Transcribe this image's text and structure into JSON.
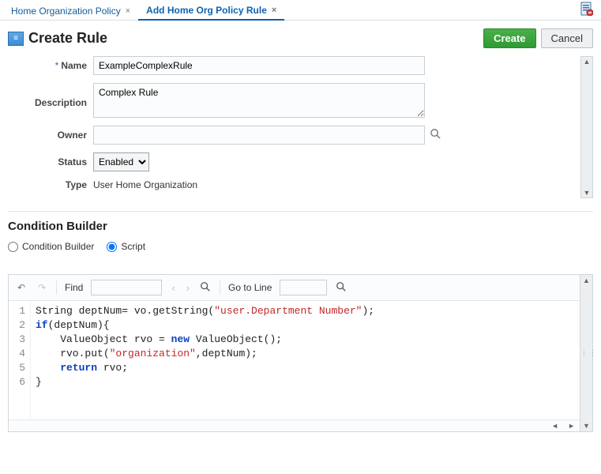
{
  "tabs": [
    {
      "label": "Home Organization Policy",
      "active": false
    },
    {
      "label": "Add Home Org Policy Rule",
      "active": true
    }
  ],
  "header": {
    "title": "Create Rule",
    "create_btn": "Create",
    "cancel_btn": "Cancel"
  },
  "form": {
    "name_label": "Name",
    "name_value": "ExampleComplexRule",
    "desc_label": "Description",
    "desc_value": "Complex Rule",
    "owner_label": "Owner",
    "owner_value": "",
    "status_label": "Status",
    "status_value": "Enabled",
    "type_label": "Type",
    "type_value": "User Home Organization"
  },
  "cond": {
    "section_title": "Condition Builder",
    "opt_builder": "Condition Builder",
    "opt_script": "Script"
  },
  "toolbar": {
    "find_label": "Find",
    "goto_label": "Go to Line"
  },
  "code": {
    "lines": [
      "String deptNum= vo.getString(\"user.Department Number\");",
      "if(deptNum){",
      "    ValueObject rvo = new ValueObject();",
      "    rvo.put(\"organization\",deptNum);",
      "    return rvo;",
      "}"
    ],
    "l1_a": "String deptNum= vo.getString(",
    "l1_b": "\"user.Department Number\"",
    "l1_c": ");",
    "l2_kw": "if",
    "l2_rest": "(deptNum){",
    "l3_a": "    ValueObject rvo = ",
    "l3_kw": "new",
    "l3_b": " ValueObject();",
    "l4_a": "    rvo.put(",
    "l4_s1": "\"organization\"",
    "l4_b": ",deptNum);",
    "l5_a": "    ",
    "l5_kw": "return",
    "l5_b": " rvo;",
    "l6": "}",
    "n1": "1",
    "n2": "2",
    "n3": "3",
    "n4": "4",
    "n5": "5",
    "n6": "6"
  }
}
